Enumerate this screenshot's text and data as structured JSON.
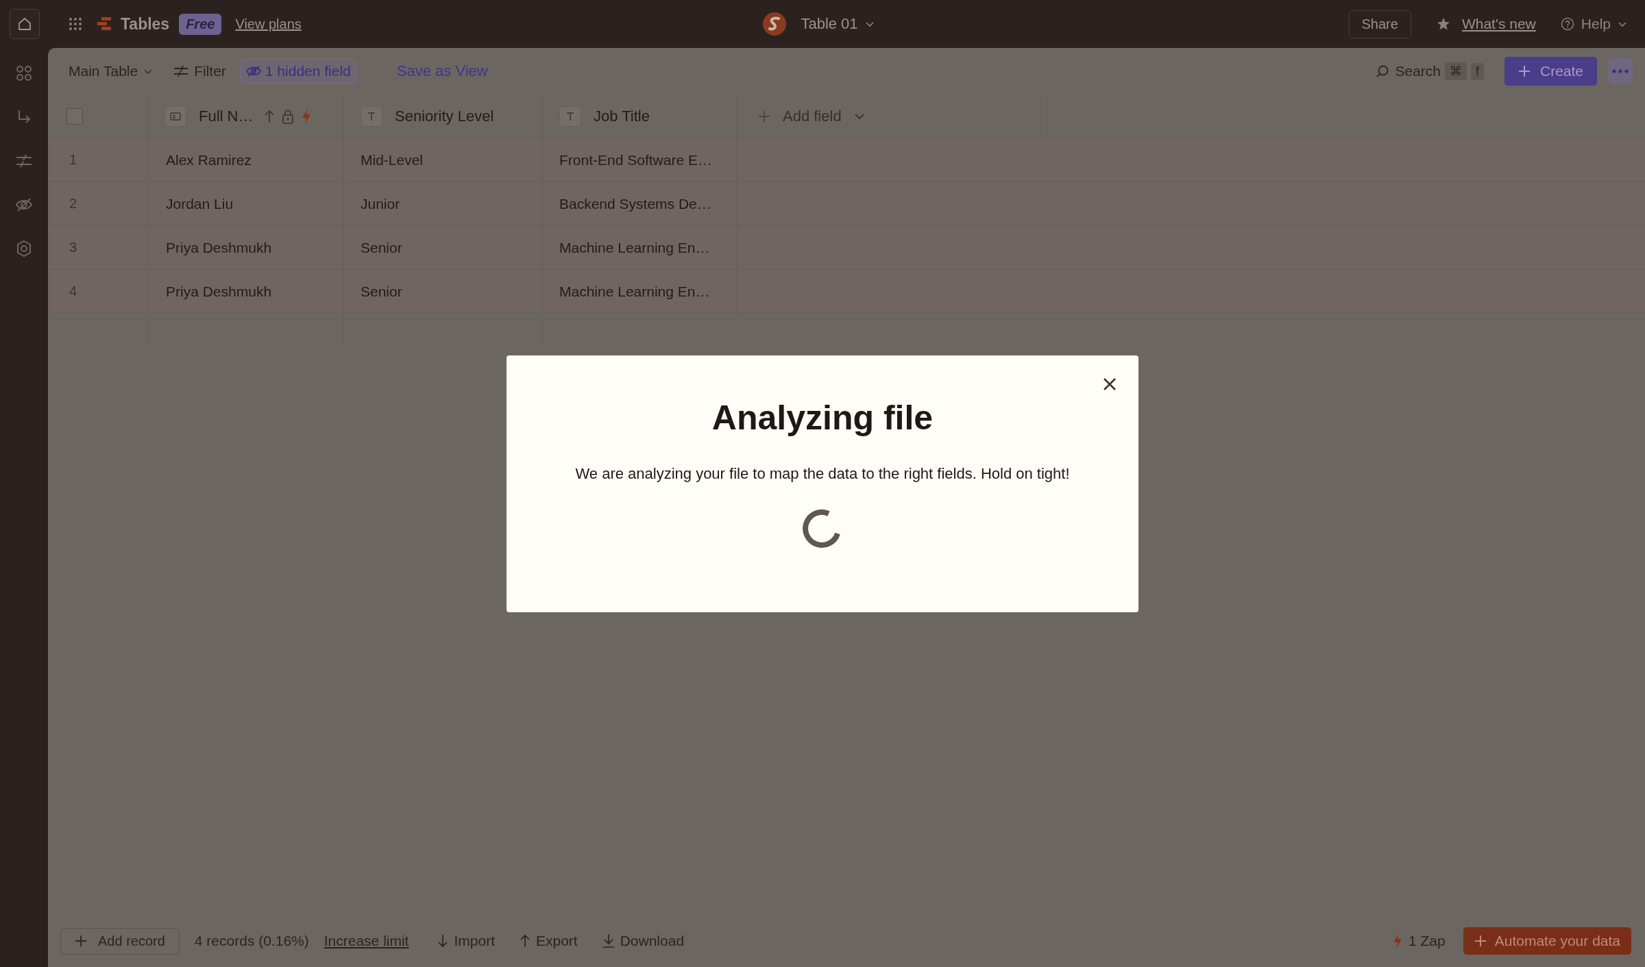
{
  "topbar": {
    "app_name": "Tables",
    "plan_badge": "Free",
    "plans_link": "View plans",
    "table_name": "Table 01",
    "share": "Share",
    "whats_new": "What's new",
    "help": "Help"
  },
  "toolbar": {
    "view": "Main Table",
    "filter": "Filter",
    "hidden_fields": "1 hidden field",
    "save_view": "Save as View",
    "search": "Search",
    "shortcut": [
      "⌘",
      "f"
    ],
    "create": "Create"
  },
  "table": {
    "columns": [
      {
        "label": "Full N…",
        "kind": "primary"
      },
      {
        "label": "Seniority Level",
        "kind": "text"
      },
      {
        "label": "Job Title",
        "kind": "text"
      }
    ],
    "add_field": "Add field",
    "select_all": {
      "checked": false
    },
    "rows": [
      {
        "number": "1",
        "cells": [
          "Alex Ramirez",
          "Mid-Level",
          "Front-End Software E…"
        ]
      },
      {
        "number": "2",
        "cells": [
          "Jordan Liu",
          "Junior",
          "Backend Systems De…"
        ]
      },
      {
        "number": "3",
        "cells": [
          "Priya Deshmukh",
          "Senior",
          "Machine Learning En…"
        ]
      },
      {
        "number": "4",
        "cells": [
          "Priya Deshmukh",
          "Senior",
          "Machine Learning En…"
        ]
      }
    ]
  },
  "footer": {
    "add_record": "Add record",
    "count": "4 records (0.16%)",
    "increase_limit": "Increase limit",
    "import": "Import",
    "export": "Export",
    "download": "Download",
    "zaps": "1 Zap",
    "automate": "Automate your data"
  },
  "dialog": {
    "title": "Analyzing file",
    "message": "We are analyzing your file to map the data to the right fields. Hold on tight!"
  }
}
